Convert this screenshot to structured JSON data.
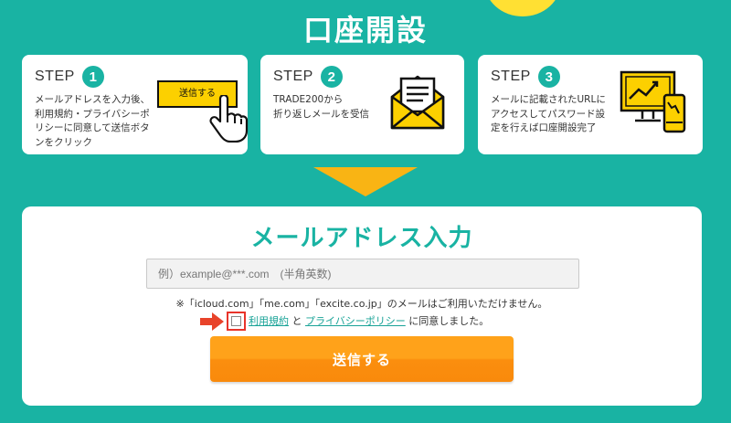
{
  "page_title": "口座開設",
  "steps": [
    {
      "label": "STEP",
      "number": "1",
      "text": "メールアドレスを入力後、\n利用規約・プライバシーポ\nリシーに同意して送信ボタ\nンをクリック",
      "illustration_button_label": "送信する",
      "icon": "hand-pointer-icon"
    },
    {
      "label": "STEP",
      "number": "2",
      "text": "TRADE200から\n折り返しメールを受信",
      "icon": "envelope-icon"
    },
    {
      "label": "STEP",
      "number": "3",
      "text": "メールに記載されたURLに\nアクセスしてパスワード設\n定を行えば口座開設完了",
      "icon": "devices-chart-icon"
    }
  ],
  "form": {
    "title": "メールアドレス入力",
    "email_placeholder": "例）example@***.com　(半角英数)",
    "email_value": "",
    "notice": "※「icloud.com」「me.com」「excite.co.jp」のメールはご利用いただけません。",
    "terms_link": "利用規約",
    "and_text": " と ",
    "privacy_link": "プライバシーポリシー",
    "agree_suffix": " に同意しました。",
    "submit_label": "送信する"
  },
  "colors": {
    "background": "#19b3a3",
    "accent_yellow": "#f9b414",
    "submit_orange": "#ffa21a",
    "checkbox_highlight": "#e8342a"
  }
}
